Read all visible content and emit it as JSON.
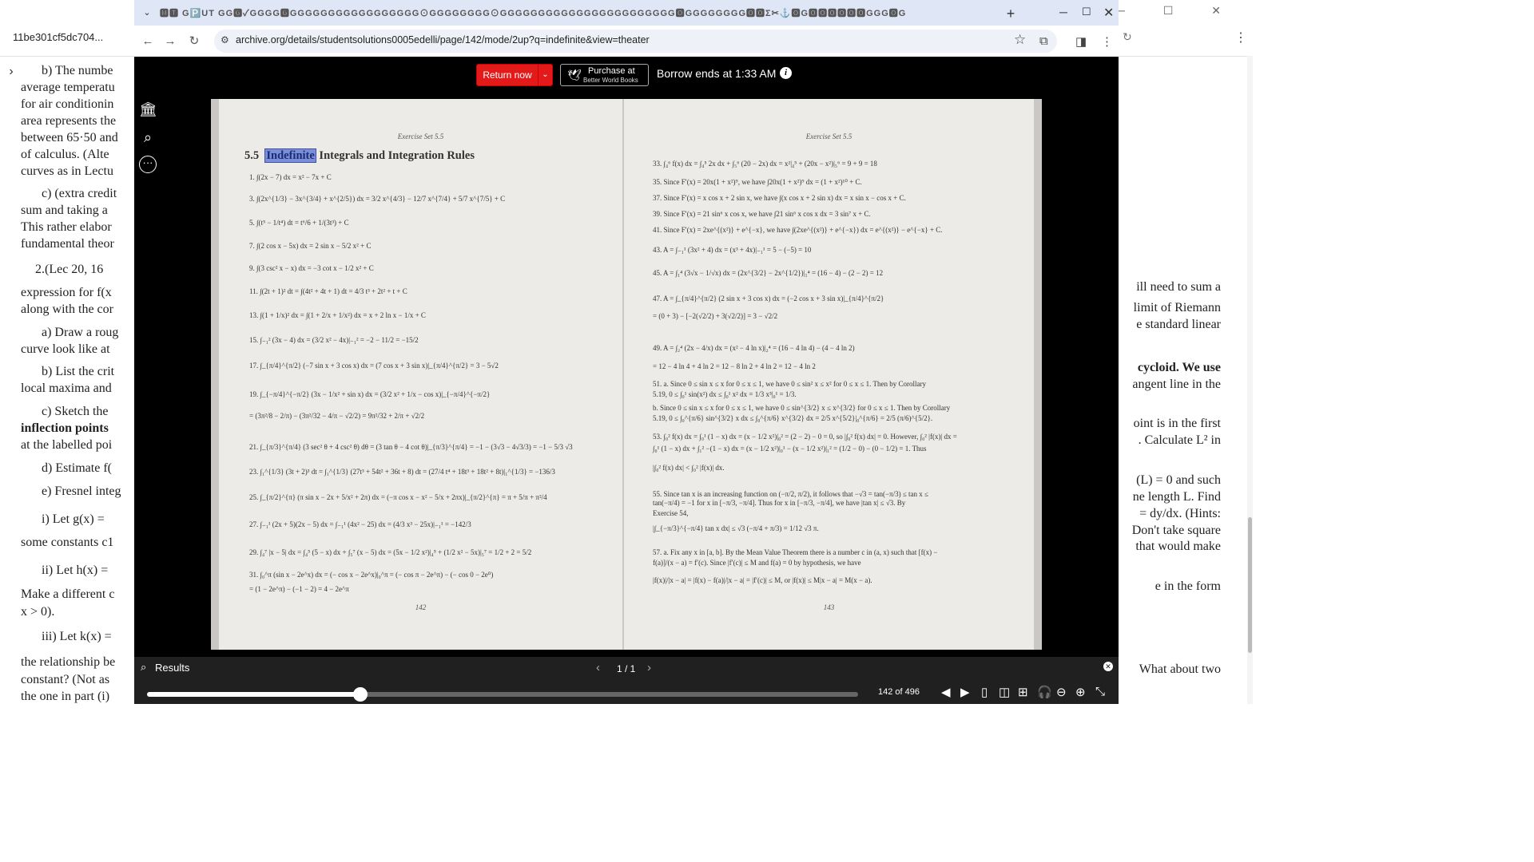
{
  "background_window": {
    "title": "11be301cf5dc704...",
    "left_lines": [
      "b) The numbe",
      "average temperatu",
      "for air conditionin",
      "area represents the",
      "between 65·50 and",
      "of calculus.  (Alte",
      "curves as in Lectu",
      "c) (extra credit",
      "sum and taking a",
      "This rather elabor",
      "fundamental theor",
      "2.(Lec 20, 16",
      "expression for f(x",
      "along with the cor",
      "a) Draw a roug",
      "curve look like at",
      "b) List the crit",
      "local maxima and",
      "c) Sketch the",
      "inflection points",
      "at the labelled poi",
      "d) Estimate f(",
      "e) Fresnel integ",
      "i) Let g(x) =",
      "some constants c1",
      "ii) Let h(x) =",
      "Make a different c",
      "x > 0).",
      "iii) Let k(x) =",
      "the relationship be",
      "constant?  (Not as",
      "the one in part (i)"
    ],
    "right_lines": [
      "ill need to sum a",
      "limit of Riemann",
      "e standard linear",
      "cycloid.  We use",
      "angent line in the",
      "oint is in the first",
      ".  Calculate L² in",
      "(L) = 0 and such",
      "ne length L. Find",
      "= dy/dx. (Hints:",
      "Don't take square",
      " that would make",
      "e in the form",
      "What about two"
    ]
  },
  "browser": {
    "tabstrip_text": "🅼🆃 G🅿️UT GG🅶✓GGGG🅶GGGGGGGGGGGGGGGGG⊙GGGGGGGG⊙GGGGGGGGGGGGGGGGGGGGGGG🅾GGGGGGGG🅾🅾Σ✂⚓🅾G🅾🅾🅾🅾🅾🅾GGG🅾G",
    "url": "archive.org/details/studentsolutions0005edelli/page/142/mode/2up?q=indefinite&view=theater"
  },
  "ia": {
    "return_label": "Return now",
    "purchase_line1": "Purchase at",
    "purchase_line2": "Better World Books",
    "borrow_text": "Borrow ends at 1:33 AM",
    "results_label": "Results",
    "results_count": "1 / 1",
    "page_count": "142 of 496",
    "progress": 0.3
  },
  "book": {
    "left_running": "Exercise Set 5.5",
    "right_running": "Exercise Set 5.5",
    "section_number": "5.5",
    "section_highlight": "Indefinite",
    "section_rest": " Integrals and Integration Rules",
    "left_page_number": "142",
    "right_page_number": "143",
    "left_equations": [
      "1.  ∫(2x − 7) dx = x² − 7x + C",
      "3.  ∫(2x^{1/3} − 3x^{3/4} + x^{2/5}) dx = 3/2 x^{4/3} − 12/7 x^{7/4} + 5/7 x^{7/5} + C",
      "5.  ∫(t⁵ − 1/t⁴) dt = t⁶/6 + 1/(3t³) + C",
      "7.  ∫(2 cos x − 5x) dx = 2 sin x − 5/2 x² + C",
      "9.  ∫(3 csc² x − x) dx = −3 cot x − 1/2 x² + C",
      "11.  ∫(2t + 1)² dt = ∫(4t² + 4t + 1) dt = 4/3 t³ + 2t² + t + C",
      "13.  ∫(1 + 1/x)² dx = ∫(1 + 2/x + 1/x²) dx = x + 2 ln x − 1/x + C",
      "15.  ∫₋₁² (3x − 4) dx = (3/2 x² − 4x)|₋₁² = −2 − 11/2 = −15/2",
      "17.  ∫_{π/4}^{π/2} (−7 sin x + 3 cos x) dx = (7 cos x + 3 sin x)|_{π/4}^{π/2} = 3 − 5√2",
      "19.  ∫_{−π/4}^{−π/2} (3x − 1/x² + sin x) dx = (3/2 x² + 1/x − cos x)|_{−π/4}^{−π/2}",
      "       = (3π²/8 − 2/π) − (3π²/32 − 4/π − √2/2) = 9π²/32 + 2/π + √2/2",
      "21.  ∫_{π/3}^{π/4} (3 sec² θ + 4 csc² θ) dθ = (3 tan θ − 4 cot θ)|_{π/3}^{π/4} = −1 − (3√3 − 4√3/3) = −1 − 5/3 √3",
      "23.  ∫₁^{1/3} (3t + 2)³ dt = ∫₁^{1/3} (27t³ + 54t² + 36t + 8) dt = (27/4 t⁴ + 18t³ + 18t² + 8t)|₁^{1/3} = −136/3",
      "25.  ∫_{π/2}^{π} (π sin x − 2x + 5/x² + 2π) dx = (−π cos x − x² − 5/x + 2πx)|_{π/2}^{π} = π + 5/π + π²/4",
      "27.  ∫₋₁¹ (2x + 5)(2x − 5) dx = ∫₋₁¹ (4x² − 25) dx = (4/3 x³ − 25x)|₋₁¹ = −142/3",
      "29.  ∫₄⁷ |x − 5| dx = ∫₄⁵ (5 − x) dx + ∫₅⁷ (x − 5) dx = (5x − 1/2 x²)|₄⁵ + (1/2 x² − 5x)|₅⁷ = 1/2 + 2 = 5/2",
      "31.  ∫₀^π (sin x − 2e^x) dx = (− cos x − 2e^x)|₀^π = (− cos π − 2e^π) − (− cos 0 − 2e⁰)",
      "       = (1 − 2e^π) − (−1 − 2) = 4 − 2e^π"
    ],
    "right_equations": [
      "33.  ∫₄⁶ f(x) dx = ∫₄⁵ 2x dx + ∫₅⁶ (20 − 2x) dx = x²|₄⁵ + (20x − x²)|₅⁶ = 9 + 9 = 18",
      "35.  Since F′(x) = 20x(1 + x²)⁹, we have ∫20x(1 + x²)⁹ dx = (1 + x²)¹⁰ + C.",
      "37.  Since F′(x) = x cos x + 2 sin x, we have ∫(x cos x + 2 sin x) dx = x sin x − cos x + C.",
      "39.  Since F′(x) = 21 sin⁶ x cos x, we have ∫21 sin⁶ x cos x dx = 3 sin⁷ x + C.",
      "41.  Since F′(x) = 2xe^{(x²)} + e^{−x}, we have ∫(2xe^{(x²)} + e^{−x}) dx = e^{(x²)} − e^{−x} + C.",
      "43.  A = ∫₋₁¹ (3x² + 4) dx = (x³ + 4x)|₋₁¹ = 5 − (−5) = 10",
      "45.  A = ∫₁⁴ (3√x − 1/√x) dx = (2x^{3/2} − 2x^{1/2})|₁⁴ = (16 − 4) − (2 − 2) = 12",
      "47.  A = ∫_{π/4}^{π/2} (2 sin x + 3 cos x) dx = (−2 cos x + 3 sin x)|_{π/4}^{π/2}",
      "       = (0 + 3) − [−2(√2/2) + 3(√2/2)] = 3 − √2/2",
      "49.  A = ∫₂⁴ (2x − 4/x) dx = (x² − 4 ln x)|₂⁴ = (16 − 4 ln 4) − (4 − 4 ln 2)",
      "       = 12 − 4 ln 4 + 4 ln 2 = 12 − 8 ln 2 + 4 ln 2 = 12 − 4 ln 2",
      "51.  a. Since 0 ≤ sin x ≤ x for 0 ≤ x ≤ 1, we have 0 ≤ sin² x ≤ x² for 0 ≤ x ≤ 1. Then by Corollary",
      "         5.19, 0 ≤ ∫₀¹ sin(x²) dx ≤ ∫₀¹ x² dx = 1/3 x³|₀¹ = 1/3.",
      "       b. Since 0 ≤ sin x ≤ x for 0 ≤ x ≤ 1, we have 0 ≤ sin^{3/2} x ≤ x^{3/2} for 0 ≤ x ≤ 1. Then by Corollary",
      "         5.19, 0 ≤ ∫₀^{π/6} sin^{3/2} x dx ≤ ∫₀^{π/6} x^{3/2} dx = 2/5 x^{5/2}|₀^{π/6} = 2/5 (π/6)^{5/2}.",
      "53.  ∫₀² f(x) dx = ∫₀¹ (1 − x) dx = (x − 1/2 x²)|₀² = (2 − 2) − 0 = 0, so |∫₀² f(x) dx| = 0. However, ∫₀² |f(x)| dx =",
      "       ∫₀¹ (1 − x) dx + ∫₁² −(1 − x) dx = (x − 1/2 x²)|₀¹ − (x − 1/2 x²)|₁² = (1/2 − 0) − (0 − 1/2) = 1. Thus",
      "                              |∫₀² f(x) dx| < ∫₀² |f(x)| dx.",
      "55.  Since tan x is an increasing function on (−π/2, π/2), it follows that −√3 = tan(−π/3) ≤ tan x ≤",
      "       tan(−π/4) = −1 for x in [−π/3, −π/4]. Thus for x in [−π/3, −π/4], we have |tan x| ≤ √3. By",
      "       Exercise 54,",
      "                    |∫_{−π/3}^{−π/4} tan x dx| ≤ √3 (−π/4 + π/3) = 1/12 √3 π.",
      "57.  a. Fix any x in [a, b]. By the Mean Value Theorem there is a number c in (a, x) such that [f(x) −",
      "         f(a)]/(x − a) = f′(c). Since |f′(c)| ≤ M and f(a) = 0 by hypothesis, we have",
      "                    |f(x)|/|x − a| = |f(x) − f(a)|/|x − a| = |f′(c)| ≤ M,   or   |f(x)| ≤ M|x − a| = M(x − a)."
    ]
  },
  "icons": {
    "library": "library-icon",
    "search": "search-icon",
    "more": "more-icon"
  },
  "colors": {
    "return_red": "#e21a1a",
    "highlight": "#7b8fd6",
    "tab_bar": "#dfe6f5"
  }
}
